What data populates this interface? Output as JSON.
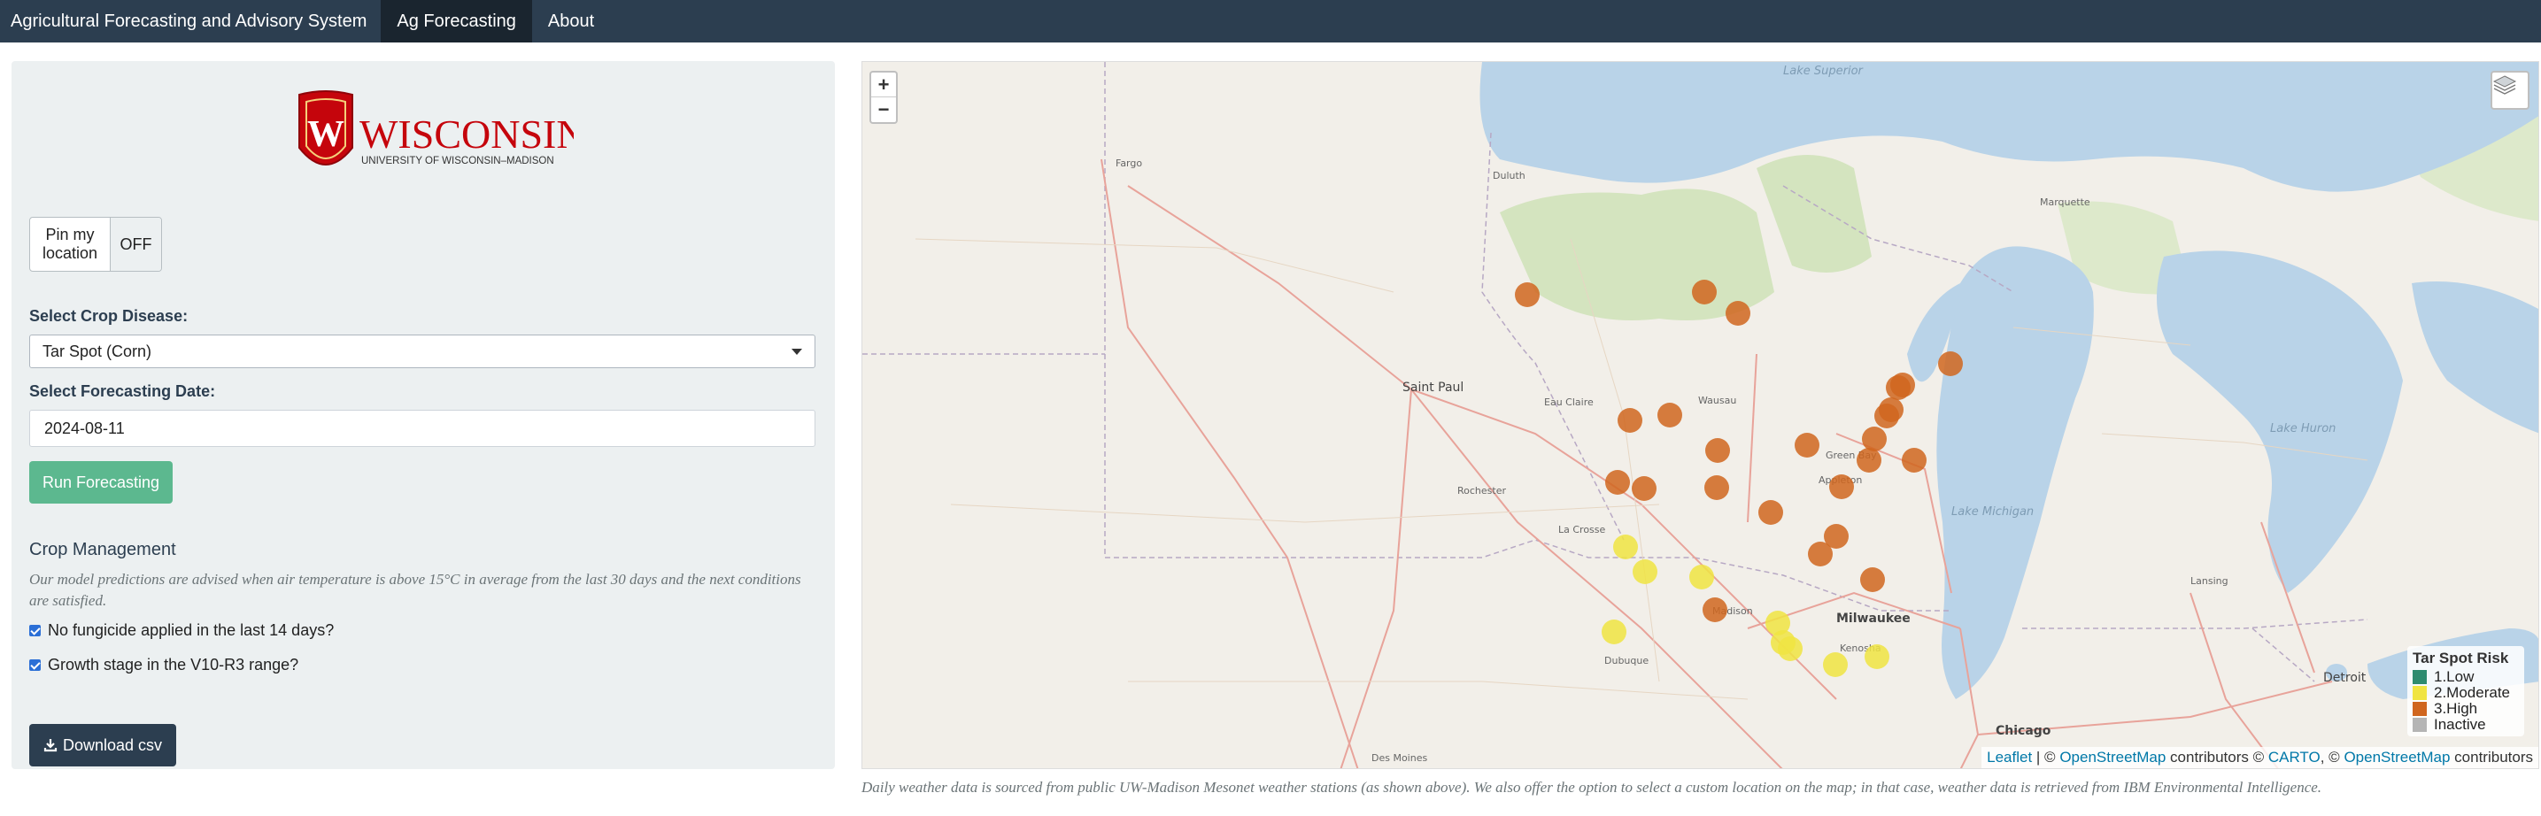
{
  "navbar": {
    "brand": "Agricultural Forecasting and Advisory System",
    "tabs": [
      {
        "label": "Ag Forecasting",
        "active": true
      },
      {
        "label": "About",
        "active": false
      }
    ]
  },
  "sidebar": {
    "logo": {
      "word": "WISCONSIN",
      "sub": "UNIVERSITY OF WISCONSIN–MADISON",
      "letter": "W"
    },
    "pin_location": {
      "label": "Pin my location",
      "state": "OFF"
    },
    "disease": {
      "label": "Select Crop Disease:",
      "value": "Tar Spot (Corn)"
    },
    "date": {
      "label": "Select Forecasting Date:",
      "value": "2024-08-11"
    },
    "run_button": "Run Forecasting",
    "crop_management": {
      "title": "Crop Management",
      "note": "Our model predictions are advised when air temperature is above 15°C in average from the last 30 days and the next conditions are satisfied.",
      "checks": [
        {
          "label": "No fungicide applied in the last 14 days?",
          "checked": true
        },
        {
          "label": "Growth stage in the V10-R3 range?",
          "checked": true
        }
      ]
    },
    "download_button": "Download csv"
  },
  "map": {
    "zoom_in": "+",
    "zoom_out": "−",
    "lakes": [
      "Lake Superior",
      "Lake Michigan",
      "Lake Huron"
    ],
    "cities": [
      "Saint Paul",
      "Milwaukee",
      "Chicago",
      "Madison",
      "Detroit",
      "Duluth",
      "Des Moines",
      "Appleton",
      "Green Bay",
      "Wausau",
      "Eau Claire",
      "La Crosse",
      "Rochester",
      "Dubuque",
      "Fargo",
      "Marquette",
      "Lansing",
      "Kenosha"
    ],
    "legend": {
      "title": "Tar Spot Risk",
      "items": [
        {
          "label": "1.Low",
          "color": "#2e8b6f"
        },
        {
          "label": "2.Moderate",
          "color": "#f0e442"
        },
        {
          "label": "3.High",
          "color": "#d0661e"
        },
        {
          "label": "Inactive",
          "color": "#b5b5b5"
        }
      ]
    },
    "attribution": {
      "leaflet": "Leaflet",
      "sep": " | © ",
      "osm": "OpenStreetMap",
      "contributors1": " contributors © ",
      "carto": "CARTO",
      "sep2": ", © ",
      "osm2": "OpenStreetMap",
      "contributors2": " contributors"
    },
    "stations_high": 28,
    "stations_moderate": 9,
    "colors": {
      "high": "#d0661e",
      "moderate": "#f0e442",
      "water": "#b9d3e8",
      "forest": "#cfe3b4"
    }
  },
  "footnote": "Daily weather data is sourced from public UW-Madison Mesonet weather stations (as shown above). We also offer the option to select a custom location on the map; in that case, weather data is retrieved from IBM Environmental Intelligence."
}
